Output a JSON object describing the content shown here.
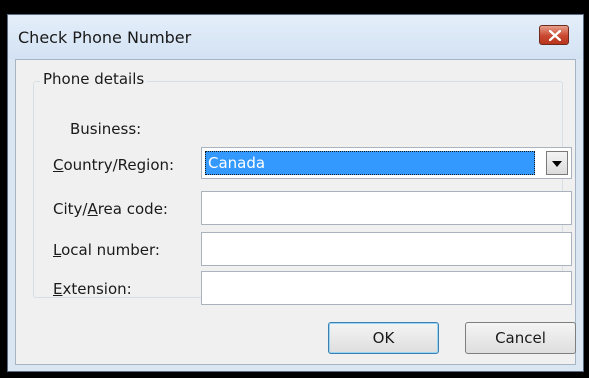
{
  "dialog": {
    "title": "Check Phone Number",
    "close_icon": "close-x-icon",
    "close_button_color": "#c9472f"
  },
  "group": {
    "title": "Phone details",
    "business_label": "Business:"
  },
  "fields": {
    "country": {
      "label": "Country/Region:",
      "mnemonic": "C",
      "rest": "ountry/Region:",
      "value": "Canada"
    },
    "city": {
      "label_pre": "City/",
      "mnemonic": "A",
      "label_post": "rea code:",
      "value": ""
    },
    "local": {
      "mnemonic": "L",
      "label_post": "ocal number:",
      "value": ""
    },
    "extension": {
      "mnemonic": "E",
      "label_post": "xtension:",
      "value": ""
    }
  },
  "buttons": {
    "ok": "OK",
    "cancel": "Cancel"
  },
  "colors": {
    "selection": "#3399ff",
    "frame": "#dbe6f3",
    "client": "#f0f0f0"
  }
}
